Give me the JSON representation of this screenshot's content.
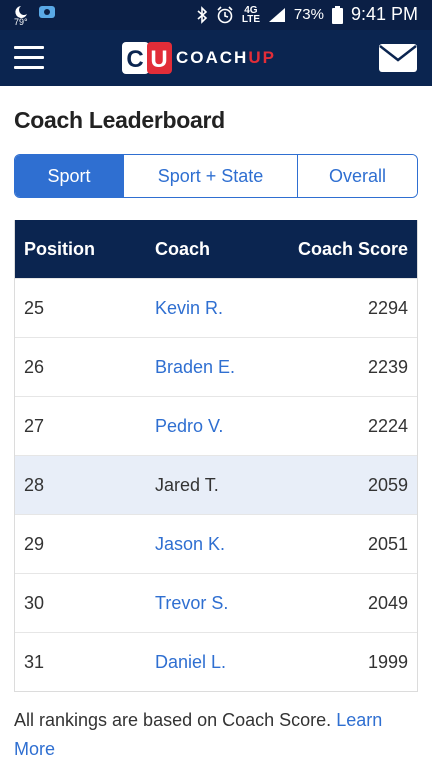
{
  "status_bar": {
    "temperature": "79°",
    "battery_percent": "73%",
    "network": "4G LTE",
    "time": "9:41 PM"
  },
  "header": {
    "logo_left": "C",
    "logo_right": "U",
    "brand_coach": "COACH",
    "brand_up": "UP",
    "brand_colors": {
      "navy": "#0b2550",
      "red": "#e22d38",
      "blue": "#2f6fd1"
    },
    "menu_icon": "hamburger-icon",
    "mail_icon": "mail-icon"
  },
  "page": {
    "title": "Coach Leaderboard"
  },
  "tabs": [
    {
      "label": "Sport",
      "active": true
    },
    {
      "label": "Sport + State",
      "active": false
    },
    {
      "label": "Overall",
      "active": false
    }
  ],
  "table": {
    "headers": {
      "position": "Position",
      "coach": "Coach",
      "score": "Coach Score"
    },
    "rows": [
      {
        "position": "25",
        "coach": "Kevin R.",
        "score": "2294",
        "linked": true
      },
      {
        "position": "26",
        "coach": "Braden E.",
        "score": "2239",
        "linked": true
      },
      {
        "position": "27",
        "coach": "Pedro V.",
        "score": "2224",
        "linked": true
      },
      {
        "position": "28",
        "coach": "Jared T.",
        "score": "2059",
        "linked": false
      },
      {
        "position": "29",
        "coach": "Jason K.",
        "score": "2051",
        "linked": true
      },
      {
        "position": "30",
        "coach": "Trevor S.",
        "score": "2049",
        "linked": true
      },
      {
        "position": "31",
        "coach": "Daniel L.",
        "score": "1999",
        "linked": true
      }
    ]
  },
  "footer": {
    "note": "All rankings are based on Coach Score. ",
    "learn_more": "Learn More"
  }
}
